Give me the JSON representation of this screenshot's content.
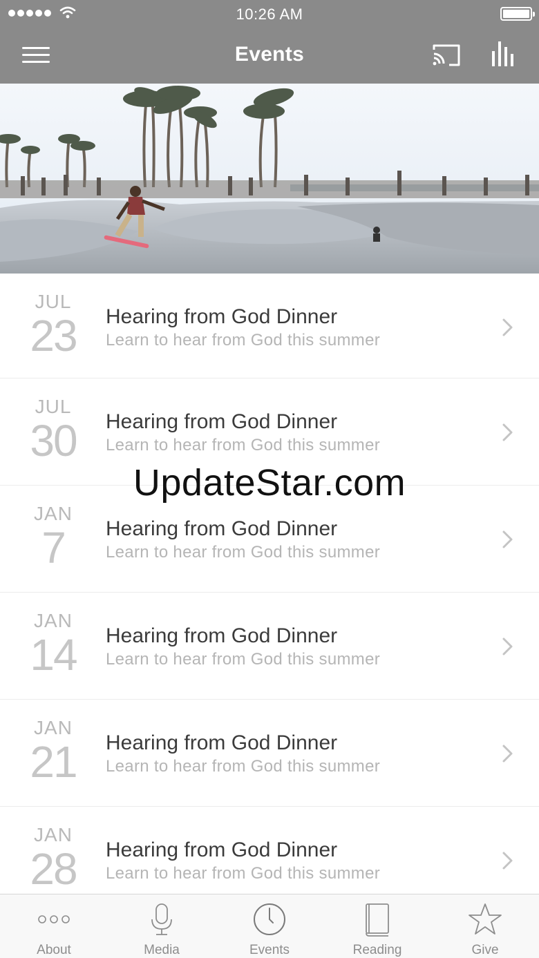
{
  "status_bar": {
    "time": "10:26 AM"
  },
  "header": {
    "title": "Events"
  },
  "events": [
    {
      "month": "JUL",
      "day": "23",
      "title": "Hearing from God Dinner",
      "subtitle": "Learn to hear from God this summer"
    },
    {
      "month": "JUL",
      "day": "30",
      "title": "Hearing from God Dinner",
      "subtitle": "Learn to hear from God this summer"
    },
    {
      "month": "JAN",
      "day": "7",
      "title": "Hearing from God Dinner",
      "subtitle": "Learn to hear from God this summer"
    },
    {
      "month": "JAN",
      "day": "14",
      "title": "Hearing from God Dinner",
      "subtitle": "Learn to hear from God this summer"
    },
    {
      "month": "JAN",
      "day": "21",
      "title": "Hearing from God Dinner",
      "subtitle": "Learn to hear from God this summer"
    },
    {
      "month": "JAN",
      "day": "28",
      "title": "Hearing from God Dinner",
      "subtitle": "Learn to hear from God this summer"
    }
  ],
  "watermark": "UpdateStar.com",
  "tab_bar": {
    "tabs": [
      {
        "label": "About",
        "icon": "more-dots-icon"
      },
      {
        "label": "Media",
        "icon": "microphone-icon"
      },
      {
        "label": "Events",
        "icon": "clock-icon"
      },
      {
        "label": "Reading",
        "icon": "book-icon"
      },
      {
        "label": "Give",
        "icon": "star-icon"
      }
    ]
  },
  "colors": {
    "bar_background": "#8a8a8a",
    "bar_foreground": "#ffffff",
    "date_text": "#b9b9b9",
    "title_text": "#3b3b3b",
    "subtitle_text": "#b5b5b5",
    "tab_label": "#8d8d8d"
  }
}
